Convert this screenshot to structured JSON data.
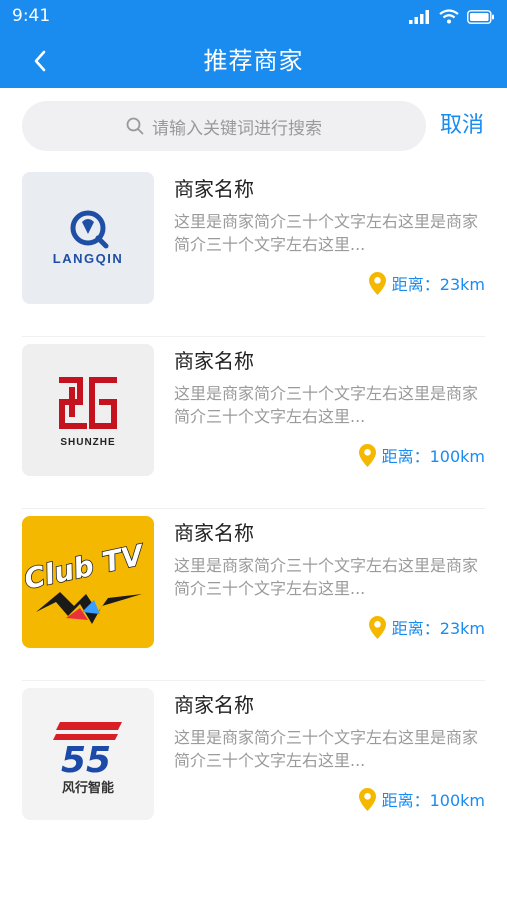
{
  "status_bar": {
    "time": "9:41"
  },
  "header": {
    "title": "推荐商家"
  },
  "search": {
    "placeholder": "请输入关键词进行搜索",
    "cancel_label": "取消"
  },
  "colors": {
    "accent": "#1a8cf0",
    "pin": "#f5b800"
  },
  "merchants": [
    {
      "name": "商家名称",
      "description": "这里是商家简介三十个文字左右这里是商家简介三十个文字左右这里...",
      "distance": "距离：23km",
      "logo": {
        "text": "LANGQIN",
        "bg": "#e9ecf1"
      }
    },
    {
      "name": "商家名称",
      "description": "这里是商家简介三十个文字左右这里是商家简介三十个文字左右这里...",
      "distance": "距离：100km",
      "logo": {
        "text": "SHUNZHE",
        "bg": "#efefef"
      }
    },
    {
      "name": "商家名称",
      "description": "这里是商家简介三十个文字左右这里是商家简介三十个文字左右这里...",
      "distance": "距离：23km",
      "logo": {
        "text": "Club TV",
        "bg": "#f5b800"
      }
    },
    {
      "name": "商家名称",
      "description": "这里是商家简介三十个文字左右这里是商家简介三十个文字左右这里...",
      "distance": "距离：100km",
      "logo": {
        "text": "风行智能",
        "bg": "#f3f3f3"
      }
    }
  ]
}
